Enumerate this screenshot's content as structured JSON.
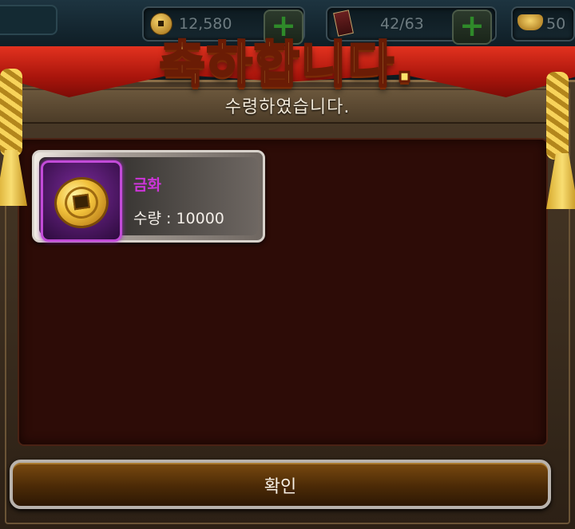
{
  "resources": {
    "gold": {
      "icon": "gold-coin-icon",
      "value": "12,580"
    },
    "cards": {
      "icon": "card-icon",
      "value": "42/63"
    },
    "ingots": {
      "icon": "gold-ingot-icon",
      "value": "50"
    }
  },
  "dialog": {
    "title": "축하합니다.",
    "subtitle": "수령하였습니다.",
    "confirm_label": "확인"
  },
  "rewards": [
    {
      "icon": "gold-coin-icon",
      "name": "금화",
      "quantity_text": "수량 : 10000",
      "rarity_color": "#c24bd8"
    }
  ],
  "colors": {
    "title_fill": "#ffe36a",
    "curtain": "#c81c10",
    "item_name": "#cc35d8",
    "panel": "#2d0c07"
  }
}
